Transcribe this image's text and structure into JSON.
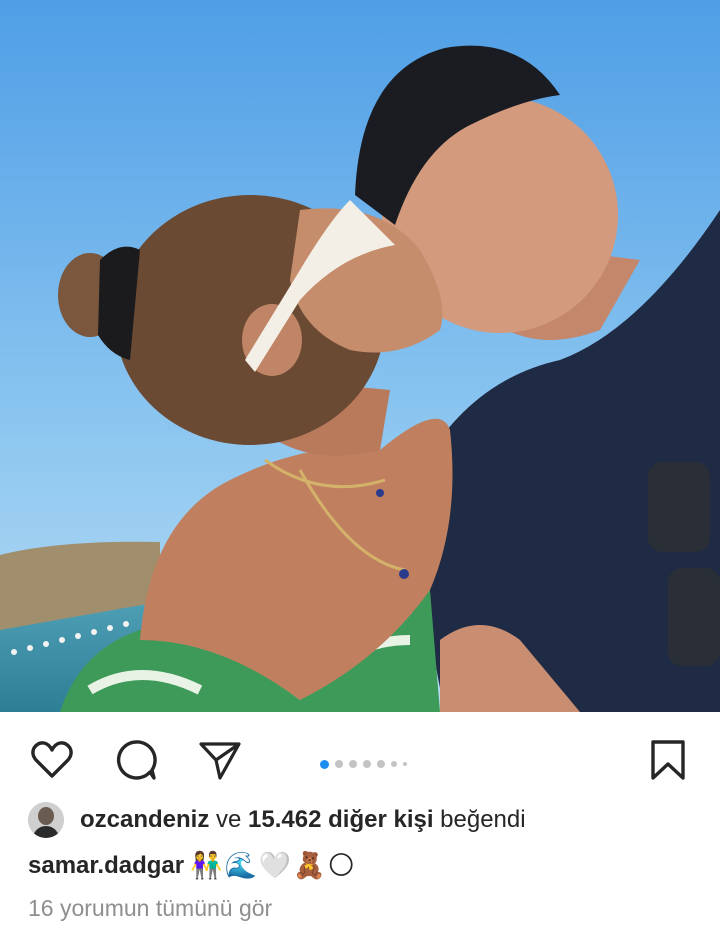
{
  "post": {
    "photo_alt": "selfie photo",
    "carousel": {
      "count": 7,
      "active_index": 0
    }
  },
  "actions": {
    "like_icon": "heart-outline-icon",
    "comment_icon": "comment-bubble-icon",
    "share_icon": "paper-plane-icon",
    "save_icon": "bookmark-outline-icon"
  },
  "likes": {
    "username": "ozcandeniz",
    "connector": " ve ",
    "count_text": "15.462 diğer kişi",
    "suffix": " beğendi"
  },
  "caption": {
    "username": "samar.dadgar",
    "text": "👫🌊🤍🧸🌕"
  },
  "comments": {
    "view_all": "16 yorumun tümünü gör"
  },
  "colors": {
    "accent_dot": "#1c8ef0",
    "text": "#262626",
    "muted": "#8e8e8e"
  }
}
